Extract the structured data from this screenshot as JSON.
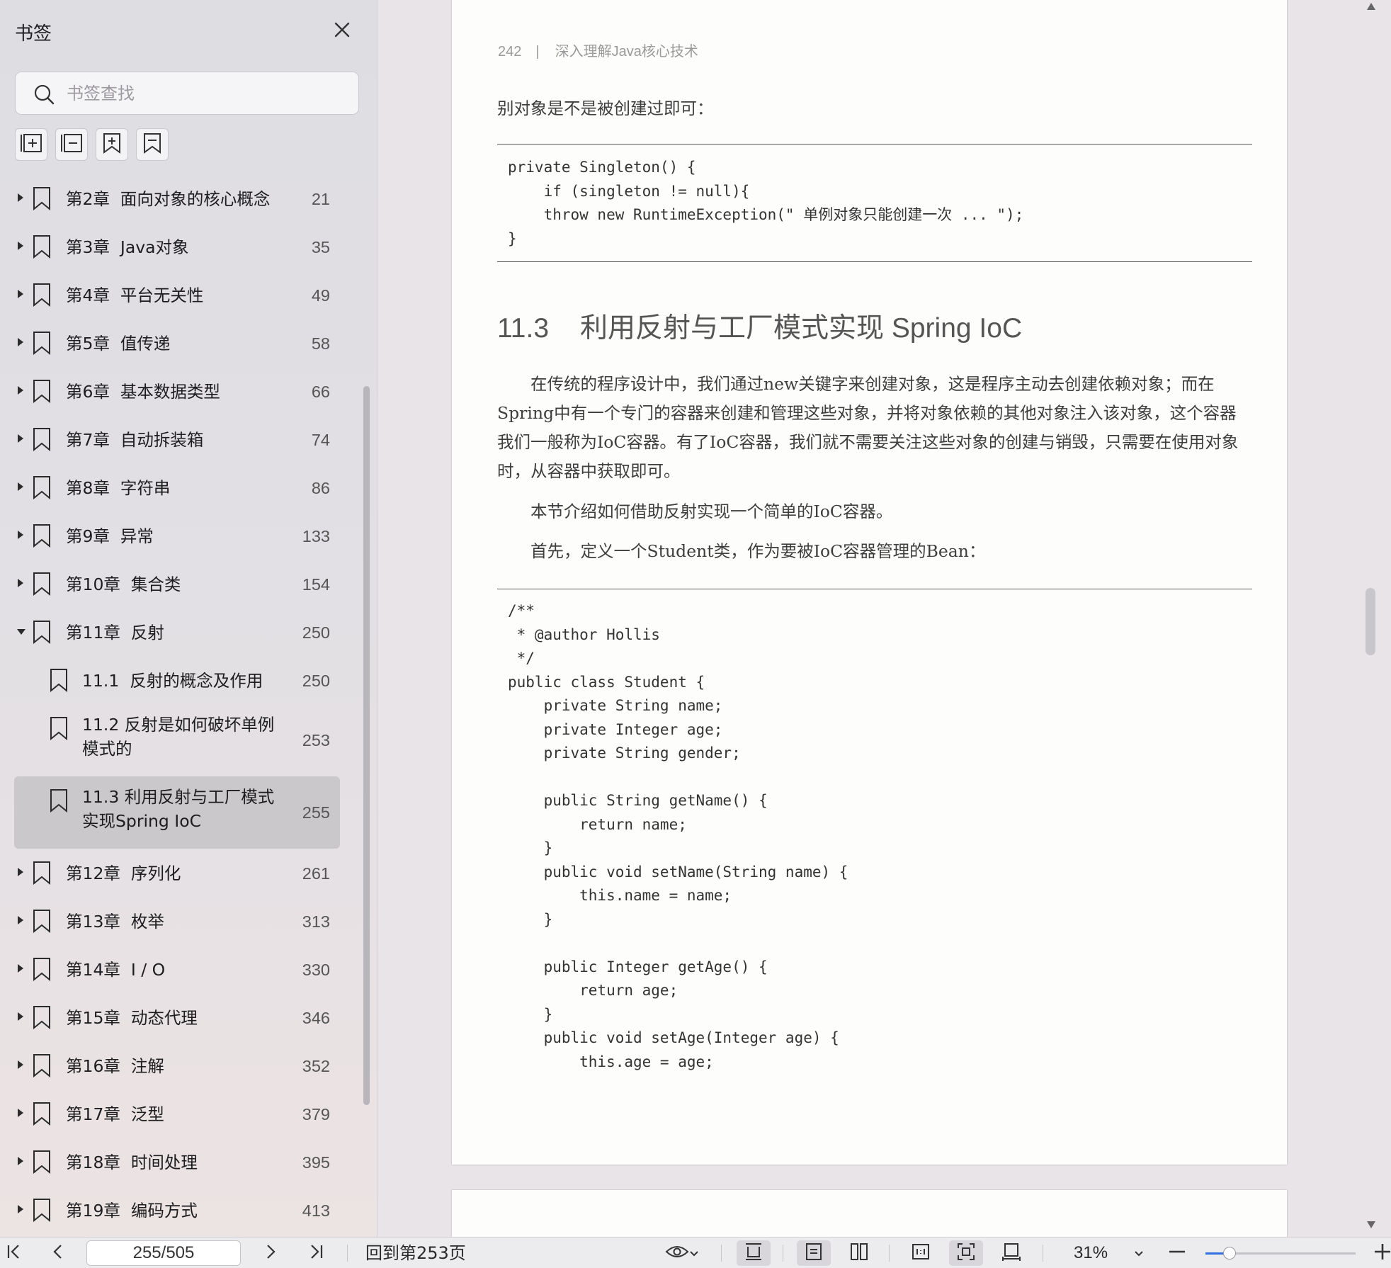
{
  "sidebar": {
    "title": "书签",
    "search_placeholder": "书签查找",
    "tools": [
      "expand-all-icon",
      "collapse-all-icon",
      "add-bookmark-icon",
      "bookmark-icon"
    ],
    "items": [
      {
        "label": "第2章  面向对象的核心概念",
        "page": "21",
        "level": 0,
        "expanded": false
      },
      {
        "label": "第3章  Java对象",
        "page": "35",
        "level": 0,
        "expanded": false
      },
      {
        "label": "第4章  平台无关性",
        "page": "49",
        "level": 0,
        "expanded": false
      },
      {
        "label": "第5章  值传递",
        "page": "58",
        "level": 0,
        "expanded": false
      },
      {
        "label": "第6章  基本数据类型",
        "page": "66",
        "level": 0,
        "expanded": false
      },
      {
        "label": "第7章  自动拆装箱",
        "page": "74",
        "level": 0,
        "expanded": false
      },
      {
        "label": "第8章  字符串",
        "page": "86",
        "level": 0,
        "expanded": false
      },
      {
        "label": "第9章  异常",
        "page": "133",
        "level": 0,
        "expanded": false
      },
      {
        "label": "第10章  集合类",
        "page": "154",
        "level": 0,
        "expanded": false
      },
      {
        "label": "第11章  反射",
        "page": "250",
        "level": 0,
        "expanded": true
      },
      {
        "label": "11.1  反射的概念及作用",
        "page": "250",
        "level": 1
      },
      {
        "label": "11.2  反射是如何破坏单例模式的",
        "page": "253",
        "level": 1
      },
      {
        "label": "11.3  利用反射与工厂模式实现Spring IoC",
        "page": "255",
        "level": 1,
        "selected": true
      },
      {
        "label": "第12章  序列化",
        "page": "261",
        "level": 0,
        "expanded": false
      },
      {
        "label": "第13章  枚举",
        "page": "313",
        "level": 0,
        "expanded": false
      },
      {
        "label": "第14章  I / O",
        "page": "330",
        "level": 0,
        "expanded": false
      },
      {
        "label": "第15章  动态代理",
        "page": "346",
        "level": 0,
        "expanded": false
      },
      {
        "label": "第16章  注解",
        "page": "352",
        "level": 0,
        "expanded": false
      },
      {
        "label": "第17章  泛型",
        "page": "379",
        "level": 0,
        "expanded": false
      },
      {
        "label": "第18章  时间处理",
        "page": "395",
        "level": 0,
        "expanded": false
      },
      {
        "label": "第19章  编码方式",
        "page": "413",
        "level": 0,
        "expanded": false
      }
    ]
  },
  "document": {
    "page_number": "242",
    "running_header": "深入理解Java核心技术",
    "intro_line": "别对象是不是被创建过即可：",
    "code1": "private Singleton() {\n    if (singleton != null){\n    throw new RuntimeException(\" 单例对象只能创建一次 ... \");\n}",
    "section_number": "11.3",
    "section_title": "利用反射与工厂模式实现 Spring IoC",
    "para1": "在传统的程序设计中，我们通过new关键字来创建对象，这是程序主动去创建依赖对象；而在Spring中有一个专门的容器来创建和管理这些对象，并将对象依赖的其他对象注入该对象，这个容器我们一般称为IoC容器。有了IoC容器，我们就不需要关注这些对象的创建与销毁，只需要在使用对象时，从容器中获取即可。",
    "para2": "本节介绍如何借助反射实现一个简单的IoC容器。",
    "para3": "首先，定义一个Student类，作为要被IoC容器管理的Bean：",
    "code2": "/**\n * @author Hollis\n */\npublic class Student {\n    private String name;\n    private Integer age;\n    private String gender;\n\n    public String getName() {\n        return name;\n    }\n    public void setName(String name) {\n        this.name = name;\n    }\n\n    public Integer getAge() {\n        return age;\n    }\n    public void setAge(Integer age) {\n        this.age = age;"
  },
  "bottombar": {
    "page_indicator": "255/505",
    "back_to_page": "回到第253页",
    "zoom": "31%",
    "zoom_fraction": 0.16
  }
}
